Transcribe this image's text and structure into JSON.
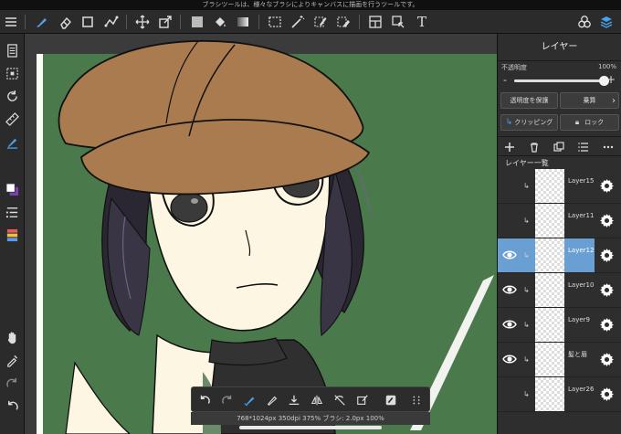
{
  "tip": "ブラシツールは、様々なブラシによりキャンバスに描画を行うツールです。",
  "panel": {
    "title": "レイヤー",
    "opacity_label": "不透明度",
    "opacity_value": "100%",
    "opacity_fraction": 1.0,
    "protect_label": "透明度を保護",
    "blend_label": "乗算",
    "clipping_label": "クリッピング",
    "lock_label": "ロック",
    "list_title": "レイヤー一覧",
    "layers": [
      {
        "name": "Layer15",
        "selected": false,
        "visible": false
      },
      {
        "name": "Layer11",
        "selected": false,
        "visible": false
      },
      {
        "name": "Layer12",
        "selected": true,
        "visible": true
      },
      {
        "name": "Layer10",
        "selected": false,
        "visible": true
      },
      {
        "name": "Layer9",
        "selected": false,
        "visible": true
      },
      {
        "name": "髪と眉",
        "selected": false,
        "visible": true
      },
      {
        "name": "Layer26",
        "selected": false,
        "visible": false
      }
    ]
  },
  "status": "768*1024px 350dpi 375% ブラシ: 2.0px 100%",
  "colors": {
    "selected_layer": "#6a9fd4",
    "canvas_bg": "#4a7a4c",
    "hat": "#a97b4f",
    "skin": "#fdf6e2",
    "hair": "#2a2732"
  }
}
